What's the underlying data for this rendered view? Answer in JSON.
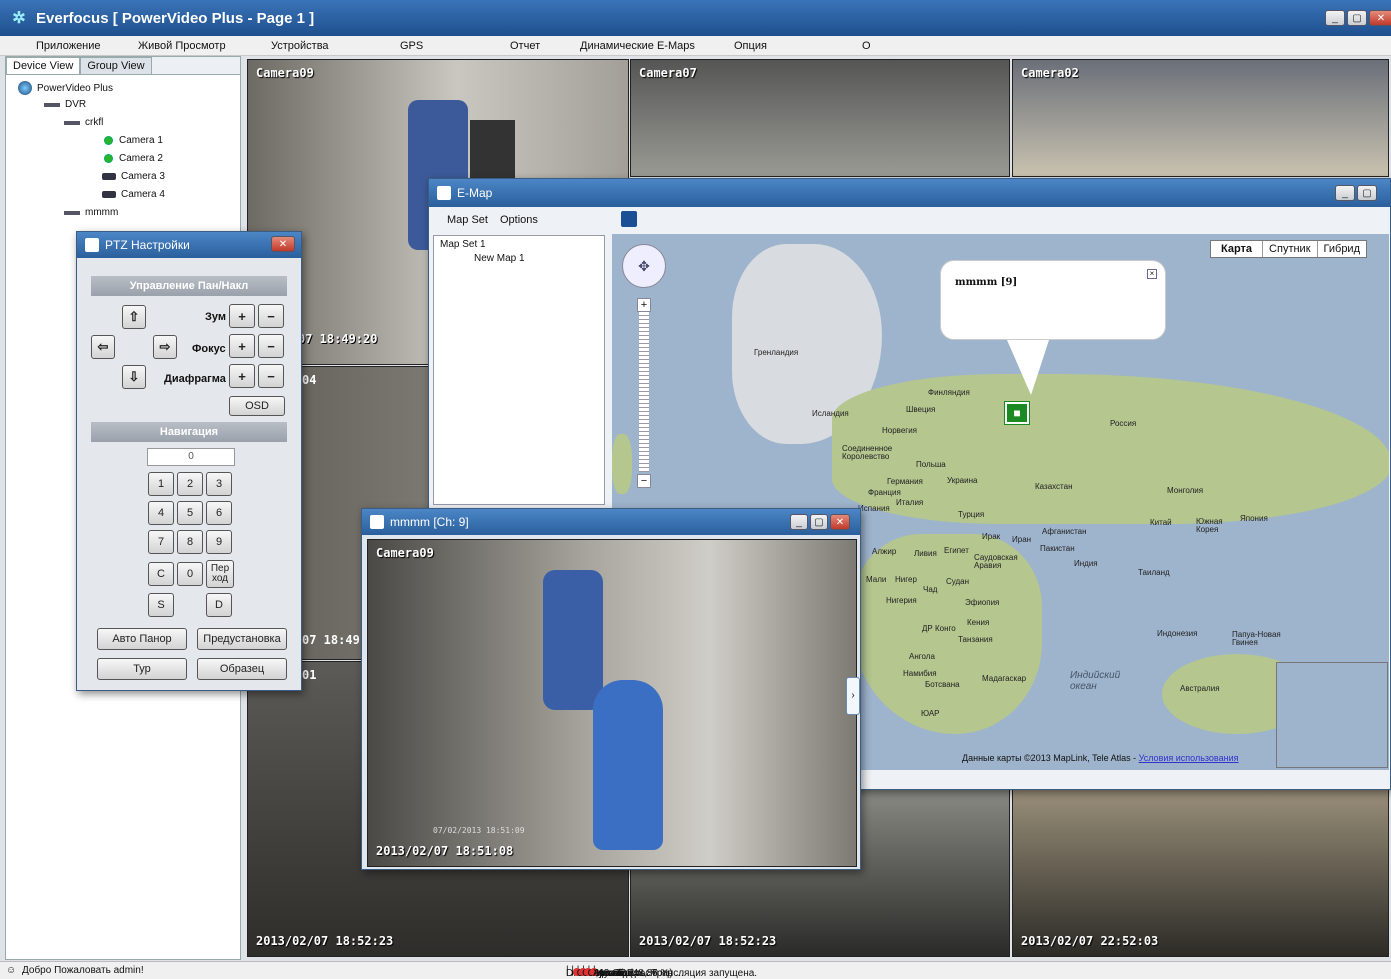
{
  "app": {
    "title": "Everfocus  [ PowerVideo Plus - Page 1 ]"
  },
  "menu": [
    "Приложение",
    "Живой Просмотр",
    "Устройства",
    "GPS",
    "Отчет",
    "Динамические E-Maps",
    "Опция",
    "О"
  ],
  "left_panel": {
    "tabs": [
      "Device View",
      "Group View"
    ],
    "tree": {
      "root": "PowerVideo Plus",
      "dvr": "DVR",
      "crkfl": "crkfl",
      "cameras": [
        "Camera 1",
        "Camera 2",
        "Camera 3",
        "Camera 4"
      ],
      "mmmm": "mmmm"
    }
  },
  "videos": {
    "camera09": {
      "label": "Camera09"
    },
    "camera07": {
      "label": "Camera07"
    },
    "camera02": {
      "label": "Camera02"
    },
    "partial": {
      "time1": "07 18:49:20",
      "ch04": "04",
      "time2": "07 18:49:2",
      "ch01": "01"
    },
    "bottom": [
      {
        "time": "2013/02/07  18:52:23"
      },
      {
        "time": "2013/02/07  18:52:23"
      },
      {
        "time": "2013/02/07  22:52:03"
      }
    ]
  },
  "ptz": {
    "title": "PTZ Настройки",
    "pan_tilt_section": "Управление Пан/Накл",
    "zoom": "Зум",
    "focus": "Фокус",
    "iris": "Диафрагма",
    "osd": "OSD",
    "nav_section": "Навигация",
    "input_value": "0",
    "keys": [
      "1",
      "2",
      "3",
      "4",
      "5",
      "6",
      "7",
      "8",
      "9"
    ],
    "key_c": "C",
    "key_0": "0",
    "key_goto": "Пер ход",
    "key_s": "S",
    "key_d": "D",
    "auto_pan": "Авто Панор",
    "preset": "Предустановка",
    "tour": "Тур",
    "pattern": "Образец"
  },
  "emap": {
    "title": "E-Map",
    "menu": [
      "Map Set",
      "Options"
    ],
    "tree": {
      "set": "Map Set 1",
      "map": "New Map 1"
    },
    "map_types": [
      "Карта",
      "Спутник",
      "Гибрид"
    ],
    "popup_title": "mmmm [9]",
    "places": [
      "Гренландия",
      "Финляндия",
      "Исландия",
      "Швеция",
      "Норвегия",
      "Россия",
      "Соединенное Королевство",
      "Польша",
      "Германия",
      "Украина",
      "Франция",
      "Италия",
      "Испания",
      "Казахстан",
      "Монголия",
      "Турция",
      "Ирак",
      "Иран",
      "Афганистан",
      "Пакистан",
      "Китай",
      "Южная Корея",
      "Япония",
      "Алжир",
      "Ливия",
      "Египет",
      "Саудовская Аравия",
      "Индия",
      "Таиланд",
      "Мали",
      "Нигер",
      "Судан",
      "Чад",
      "Нигерия",
      "Эфиопия",
      "ДР Конго",
      "Кения",
      "Танзания",
      "Ангола",
      "Намибия",
      "Ботсвана",
      "Мадагаскар",
      "ЮАР",
      "Индонезия",
      "Папуа-Новая Гвинея",
      "Австралия",
      "Индийский океан"
    ],
    "attribution": "Данные карты ©2013 MapLink, Tele Atlas - ",
    "terms": "Условия использования"
  },
  "channel_window": {
    "title": "mmmm [Ch: 9]",
    "label": "Camera09",
    "time": "2013/02/07  18:51:08",
    "osd_time": "07/02/2013  18:51:09"
  },
  "status": {
    "welcome": "Добро Пожаловать admin!",
    "disk": "D: 407,43 GB (48,86 %) ...",
    "auto_archive": "Авто архив...",
    "rec_status": "Статус зап...",
    "alarm_status": "Статус Тре...",
    "page": "Страница с...",
    "mode": "Живой Просмотр",
    "activity": "Активность: Трансляция запущена."
  },
  "colors": {
    "title_bar": "#2a5f9c",
    "camera_online": "#2ab52a",
    "alert": "#dd3333",
    "map_land": "#b5c68f",
    "map_water": "#9eb4cc"
  }
}
